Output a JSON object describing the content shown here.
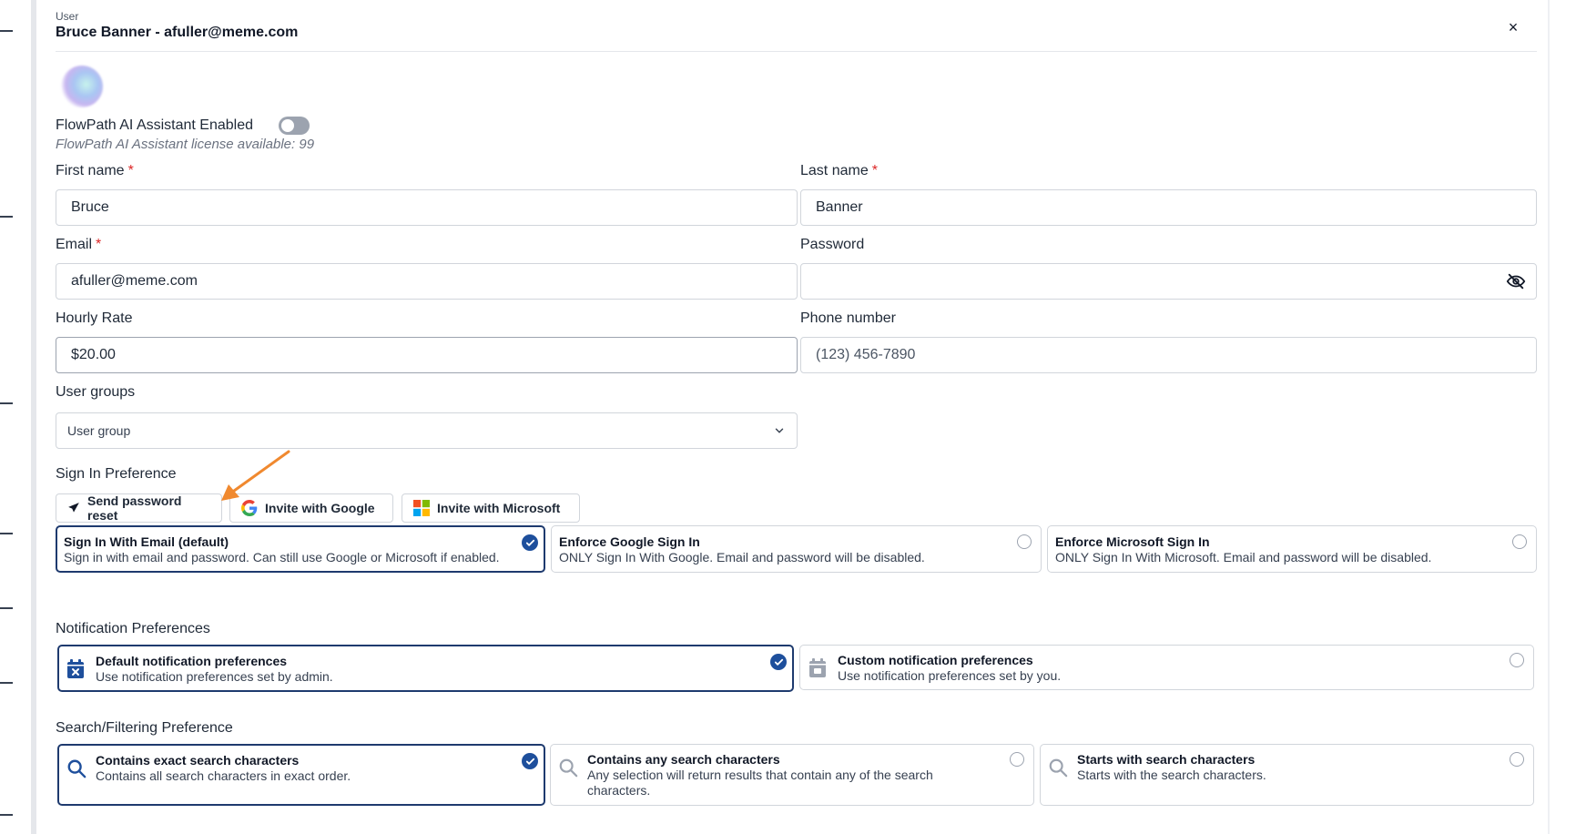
{
  "header": {
    "kicker": "User",
    "title": "Bruce Banner - afuller@meme.com",
    "close_label": "×"
  },
  "ai_assistant": {
    "label": "FlowPath AI Assistant Enabled",
    "enabled": false,
    "license_text": "FlowPath AI Assistant license available: 99"
  },
  "fields": {
    "first_name": {
      "label": "First name",
      "required_mark": "*",
      "value": "Bruce"
    },
    "last_name": {
      "label": "Last name",
      "required_mark": "*",
      "value": "Banner"
    },
    "email": {
      "label": "Email",
      "required_mark": "*",
      "value": "afuller@meme.com"
    },
    "password": {
      "label": "Password",
      "value": ""
    },
    "hourly_rate": {
      "label": "Hourly Rate",
      "value": "$20.00"
    },
    "phone": {
      "label": "Phone number",
      "placeholder": "(123) 456-7890"
    },
    "user_groups": {
      "label": "User groups",
      "value": "User group"
    }
  },
  "sign_in": {
    "section_label": "Sign In Preference",
    "buttons": {
      "password_reset": "Send password reset",
      "invite_google": "Invite with Google",
      "invite_microsoft": "Invite with Microsoft"
    },
    "options": [
      {
        "title": "Sign In With Email (default)",
        "desc": "Sign in with email and password. Can still use Google or Microsoft if enabled.",
        "selected": true
      },
      {
        "title": "Enforce Google Sign In",
        "desc": "ONLY Sign In With Google. Email and password will be disabled.",
        "selected": false
      },
      {
        "title": "Enforce Microsoft Sign In",
        "desc": "ONLY Sign In With Microsoft. Email and password will be disabled.",
        "selected": false
      }
    ]
  },
  "notifications": {
    "section_label": "Notification Preferences",
    "options": [
      {
        "title": "Default notification preferences",
        "desc": "Use notification preferences set by admin.",
        "selected": true
      },
      {
        "title": "Custom notification preferences",
        "desc": "Use notification preferences set by you.",
        "selected": false
      }
    ]
  },
  "search": {
    "section_label": "Search/Filtering Preference",
    "options": [
      {
        "title": "Contains exact search characters",
        "desc": "Contains all search characters in exact order.",
        "selected": true
      },
      {
        "title": "Contains any search characters",
        "desc": "Any selection will return results that contain any of the search characters.",
        "selected": false
      },
      {
        "title": "Starts with search characters",
        "desc": "Starts with the search characters.",
        "selected": false
      }
    ]
  },
  "colors": {
    "primary": "#1e4f9c",
    "selected_border": "#1e3a6e",
    "required": "#dc2626",
    "annotation_arrow": "#f0892f",
    "google_blue": "#4285F4",
    "google_red": "#EA4335",
    "google_yellow": "#FBBC05",
    "google_green": "#34A853",
    "ms_red": "#F25022",
    "ms_green": "#7FBA00",
    "ms_blue": "#00A4EF",
    "ms_yellow": "#FFB900"
  }
}
